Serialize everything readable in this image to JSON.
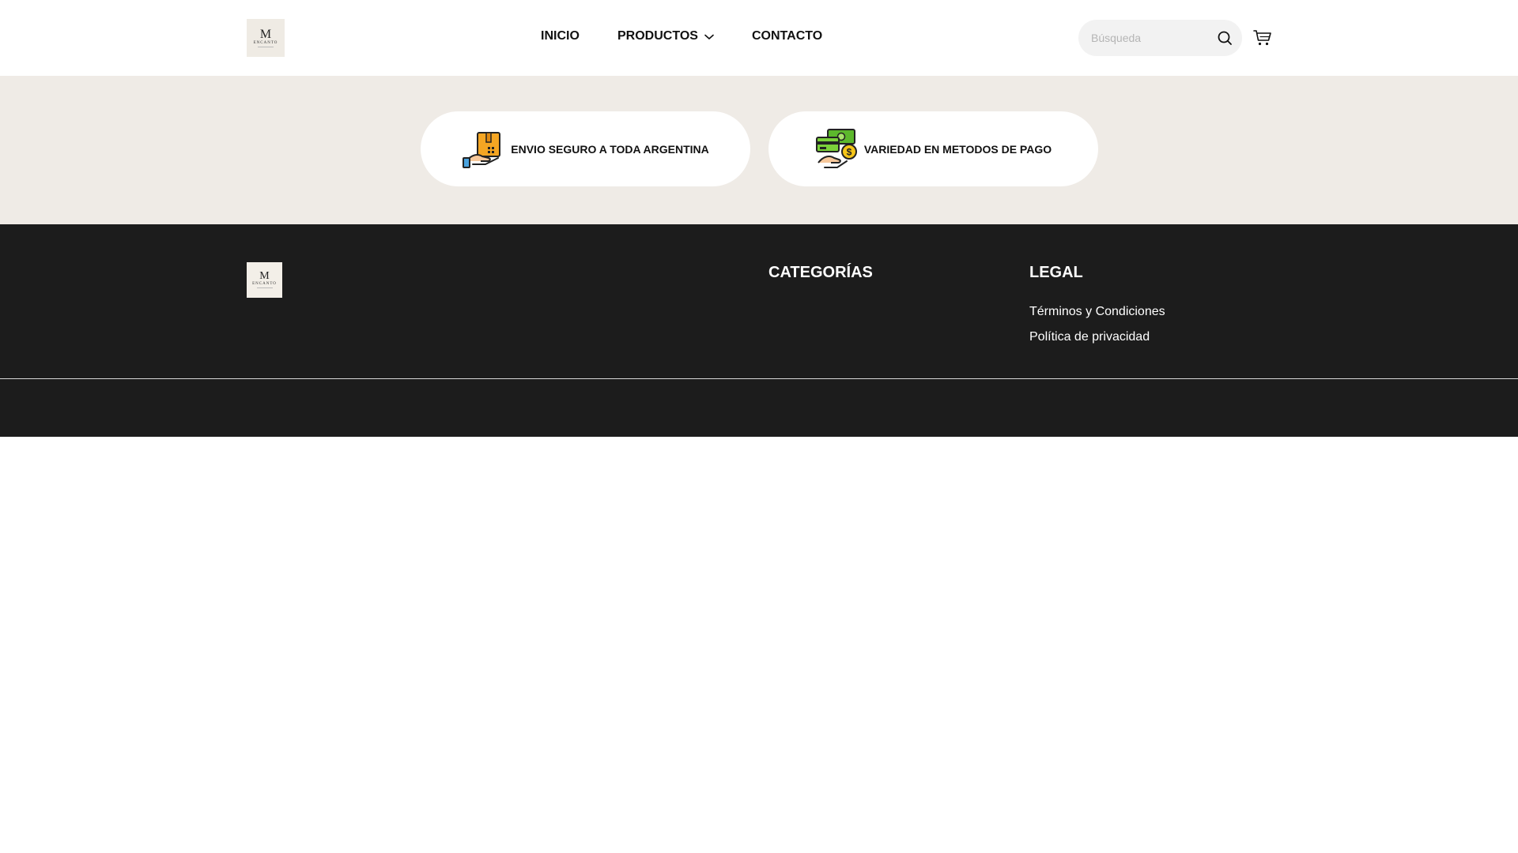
{
  "header": {
    "logo": {
      "letter": "M",
      "word": "ENCANTO"
    },
    "nav": [
      {
        "label": "INICIO"
      },
      {
        "label": "PRODUCTOS"
      },
      {
        "label": "CONTACTO"
      }
    ],
    "search": {
      "placeholder": "Búsqueda",
      "value": ""
    }
  },
  "benefits": [
    {
      "label": "ENVIO SEGURO A TODA ARGENTINA",
      "icon": "delivery-box-hand-icon"
    },
    {
      "label": "VARIEDAD EN METODOS DE PAGO",
      "icon": "money-card-hand-icon"
    }
  ],
  "footer": {
    "logo": {
      "letter": "M",
      "word": "ENCANTO"
    },
    "categories_heading": "CATEGORÍAS",
    "legal_heading": "LEGAL",
    "legal_links": [
      {
        "label": "Términos y Condiciones"
      },
      {
        "label": "Política de privacidad"
      }
    ]
  },
  "colors": {
    "band_background": "#efebe6",
    "footer_background": "#1c1c1c",
    "search_background": "#f2f2f2",
    "icon_orange": "#f5a623",
    "icon_green": "#5cb82c",
    "icon_gold": "#f5c518"
  }
}
